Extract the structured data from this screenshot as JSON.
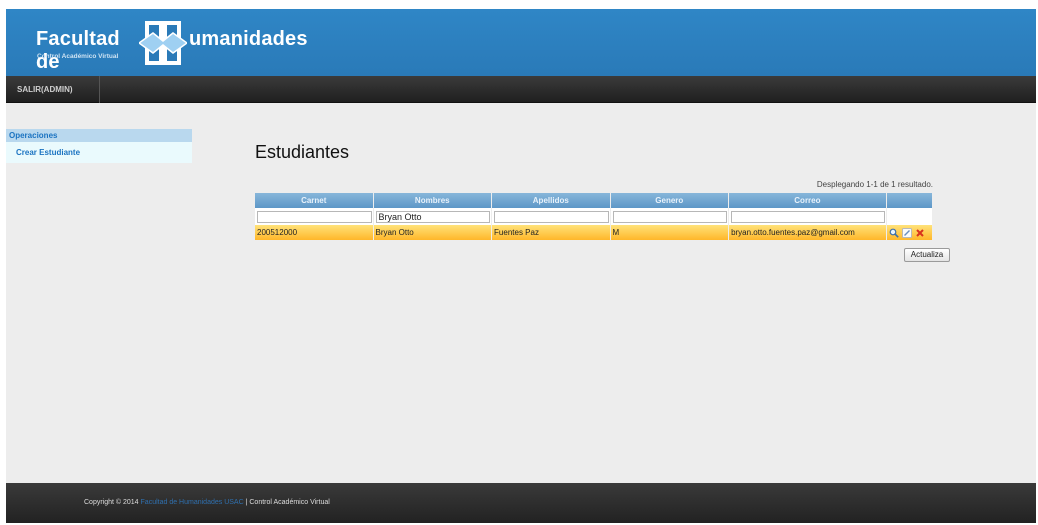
{
  "header": {
    "logo_left": "Facultad de",
    "logo_right": "umanidades",
    "logo_sub": "Control Académico Virtual"
  },
  "nav": {
    "items": [
      {
        "label": "SALIR(ADMIN)"
      }
    ]
  },
  "sidebar": {
    "heading": "Operaciones",
    "links": [
      {
        "label": "Crear Estudiante"
      }
    ]
  },
  "main": {
    "title": "Estudiantes",
    "summary": "Desplegando 1-1 de 1 resultado.",
    "columns": [
      "Carnet",
      "Nombres",
      "Apellidos",
      "Genero",
      "Correo"
    ],
    "filters": [
      "",
      "Bryan Otto",
      "",
      "",
      ""
    ],
    "rows": [
      {
        "carnet": "200512000",
        "nombres": "Bryan Otto",
        "apellidos": "Fuentes Paz",
        "genero": "M",
        "correo": "bryan.otto.fuentes.paz@gmail.com"
      }
    ],
    "row_actions": [
      "view-icon",
      "edit-icon",
      "delete-icon"
    ],
    "update_button": "Actualiza"
  },
  "footer": {
    "prefix": "Copyright © 2014",
    "link": "Facultad de Humanidades USAC",
    "suffix": "| Control Académico Virtual"
  },
  "colors": {
    "header_blue": "#2f86c6",
    "nav_dark": "#2a2a2a",
    "row_highlight": "#ffc940",
    "grid_header": "#6ea4cf",
    "link_blue": "#1b73c1"
  }
}
